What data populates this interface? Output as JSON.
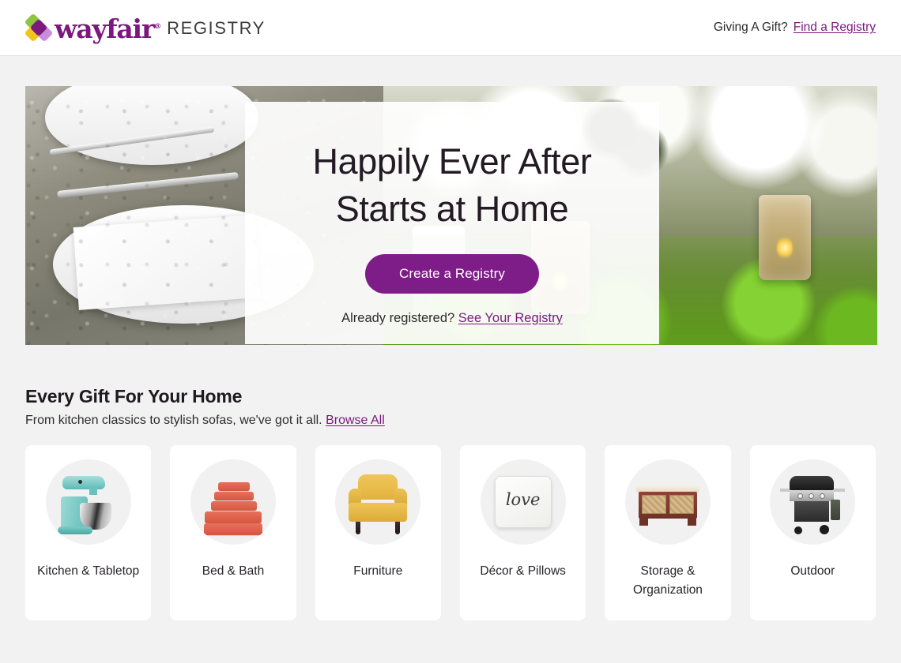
{
  "header": {
    "logo_word": "wayfair",
    "logo_tm": "®",
    "logo_sub": "REGISTRY",
    "gift_prompt": "Giving A Gift?",
    "find_registry_link": "Find a Registry"
  },
  "hero": {
    "title_line1": "Happily Ever After",
    "title_line2": "Starts at Home",
    "cta_label": "Create a Registry",
    "already_registered": "Already registered?",
    "see_registry_link": "See Your Registry"
  },
  "section": {
    "title": "Every Gift For Your Home",
    "subtitle": "From kitchen classics to stylish sofas, we've got it all.",
    "browse_all_link": "Browse All"
  },
  "categories": [
    {
      "label": "Kitchen & Tabletop",
      "icon": "stand-mixer-icon"
    },
    {
      "label": "Bed & Bath",
      "icon": "towels-icon"
    },
    {
      "label": "Furniture",
      "icon": "armchair-icon"
    },
    {
      "label": "Décor & Pillows",
      "icon": "love-pillow-icon"
    },
    {
      "label": "Storage & Organization",
      "icon": "storage-bench-icon"
    },
    {
      "label": "Outdoor",
      "icon": "gas-grill-icon"
    }
  ],
  "pillow_word": "love",
  "colors": {
    "brand_purple": "#7b187e",
    "cta_purple": "#7e1c88",
    "page_background": "#f2f2f2",
    "card_background": "#ffffff",
    "thumb_background": "#f1f1f1",
    "text_dark": "#1f1a1f"
  }
}
